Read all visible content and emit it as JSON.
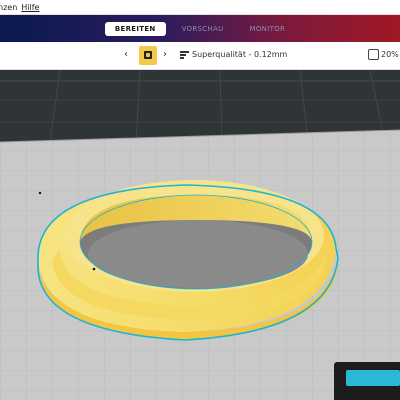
{
  "menu": {
    "items": [
      "nzen",
      "Hilfe"
    ]
  },
  "header": {
    "stages": [
      {
        "label": "BEREITEN",
        "active": true
      },
      {
        "label": "VORSCHAU",
        "active": false
      },
      {
        "label": "MONITOR",
        "active": false
      }
    ]
  },
  "toolbar": {
    "prev_icon": "chevron-left-icon",
    "next_icon": "chevron-right-icon",
    "printer_icon": "printer-icon",
    "quality_icon": "quality-profile-icon",
    "quality_label": "Superqualität - 0.12mm",
    "infill_icon": "infill-icon",
    "infill_label": "20%"
  },
  "viewport": {
    "object_name": "ring",
    "colors": {
      "object_fill": "#f6e07a",
      "object_shade": "#f2c640",
      "outline": "#1ab4d8",
      "bed": "#c8c8c8",
      "walls": "#2f3436"
    }
  },
  "slice_button": {
    "color": "#2ab8d8"
  }
}
